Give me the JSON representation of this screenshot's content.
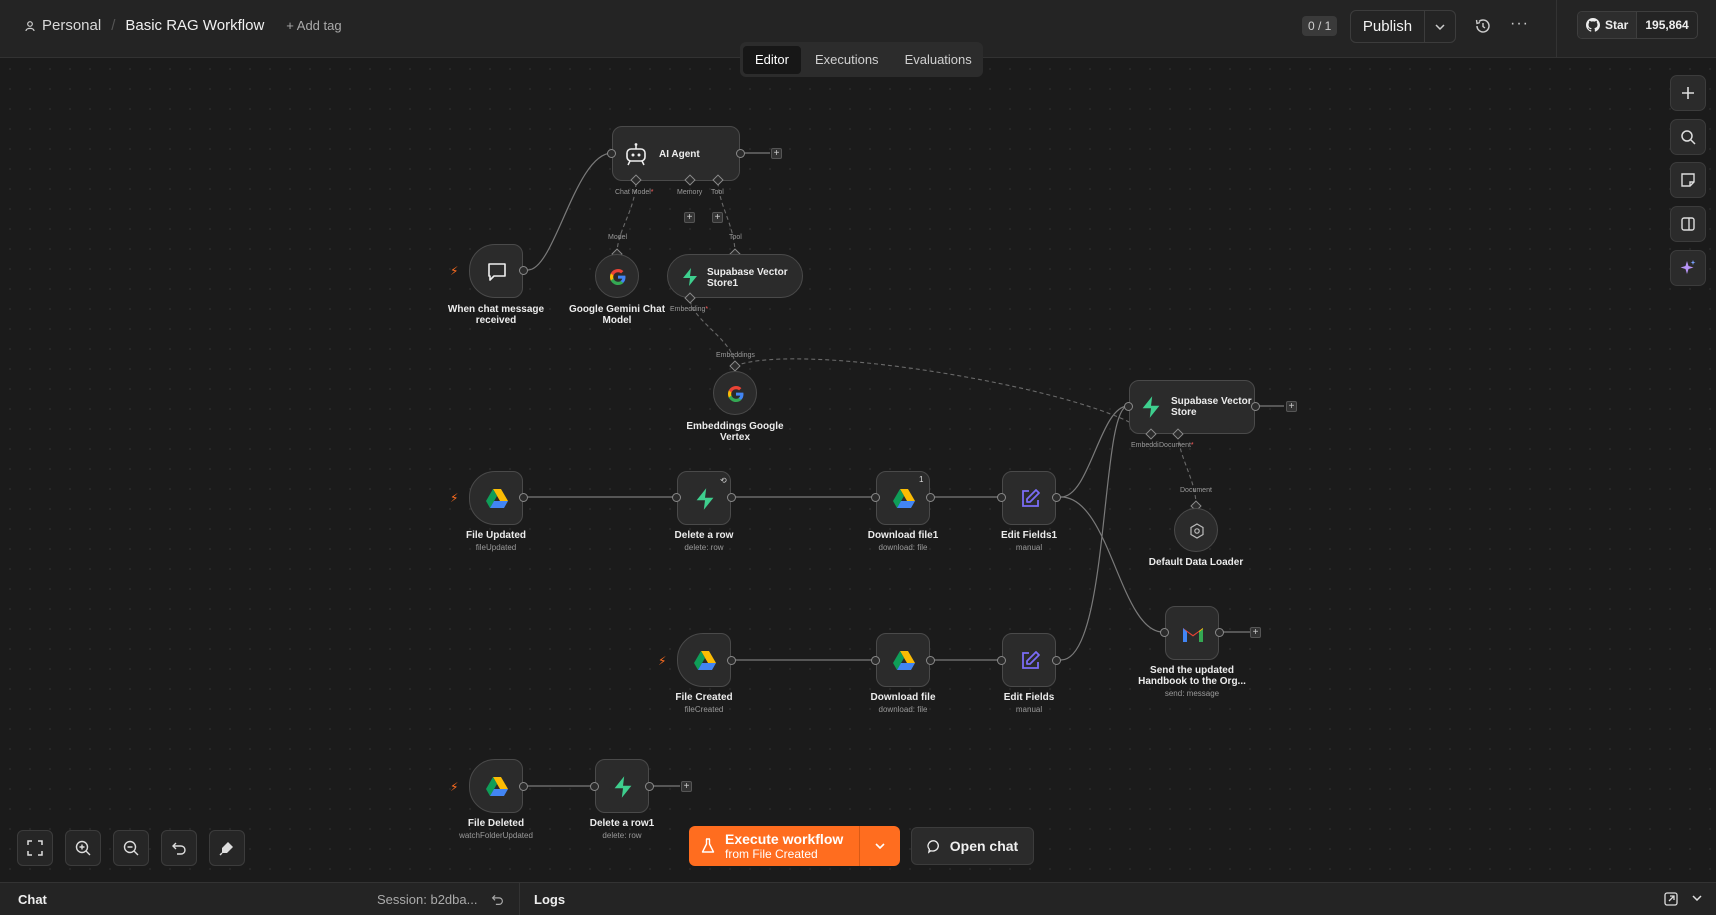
{
  "header": {
    "project": "Personal",
    "workflow_title": "Basic RAG Workflow",
    "add_tag": "+ Add tag",
    "version_count": "0 / 1",
    "publish_label": "Publish",
    "github_star": "Star",
    "github_count": "195,864"
  },
  "tabs": [
    {
      "label": "Editor",
      "active": true
    },
    {
      "label": "Executions",
      "active": false
    },
    {
      "label": "Evaluations",
      "active": false
    }
  ],
  "nodes": {
    "ai_agent": {
      "title": "AI Agent",
      "ports": {
        "chat_model": "Chat Model",
        "memory": "Memory",
        "tool": "Tool"
      }
    },
    "chat_trigger": {
      "label_1": "When chat message",
      "label_2": "received"
    },
    "gemini": {
      "label_1": "Google Gemini Chat",
      "label_2": "Model",
      "port": "Model"
    },
    "supabase_store1": {
      "title_1": "Supabase Vector",
      "title_2": "Store1",
      "port_top": "Tool",
      "port_bottom": "Embedding"
    },
    "embeddings": {
      "label_1": "Embeddings Google",
      "label_2": "Vertex",
      "port": "Embeddings"
    },
    "supabase_store": {
      "title_1": "Supabase Vector",
      "title_2": "Store",
      "port_embedding": "Embeddi",
      "port_document": "Document"
    },
    "default_loader": {
      "label": "Default Data Loader",
      "port": "Document"
    },
    "file_updated": {
      "label": "File Updated",
      "sub": "fileUpdated"
    },
    "delete_row": {
      "label": "Delete a row",
      "sub": "delete: row"
    },
    "download_file1": {
      "label": "Download file1",
      "sub": "download: file",
      "badge": "1"
    },
    "edit_fields1": {
      "label": "Edit Fields1",
      "sub": "manual"
    },
    "gmail": {
      "label_1": "Send the updated",
      "label_2": "Handbook to the Org...",
      "sub": "send: message"
    },
    "file_created": {
      "label": "File Created",
      "sub": "fileCreated"
    },
    "download_file": {
      "label": "Download file",
      "sub": "download: file"
    },
    "edit_fields": {
      "label": "Edit Fields",
      "sub": "manual"
    },
    "file_deleted": {
      "label": "File Deleted",
      "sub": "watchFolderUpdated"
    },
    "delete_row1": {
      "label": "Delete a row1",
      "sub": "delete: row"
    }
  },
  "actions": {
    "execute_title": "Execute workflow",
    "execute_sub": "from File Created",
    "open_chat": "Open chat"
  },
  "bottom": {
    "chat": "Chat",
    "session": "Session: b2dba...",
    "logs": "Logs"
  },
  "colors": {
    "accent": "#ff6d1f",
    "supabase_green": "#3ecf8e",
    "edit_purple": "#7b6cf6",
    "canvas": "#1b1b1b"
  },
  "icons": [
    "user-icon",
    "history-icon",
    "more-icon",
    "github-icon",
    "plus-icon",
    "search-icon",
    "sticky-note-icon",
    "panel-icon",
    "sparkle-icon",
    "fit-view-icon",
    "zoom-in-icon",
    "zoom-out-icon",
    "undo-icon",
    "clear-icon",
    "flask-icon",
    "chat-bubble-icon",
    "robot-icon",
    "google-g-icon",
    "supabase-bolt-icon",
    "google-drive-icon",
    "pencil-icon",
    "gmail-icon",
    "loader-icon",
    "lightning-icon"
  ]
}
